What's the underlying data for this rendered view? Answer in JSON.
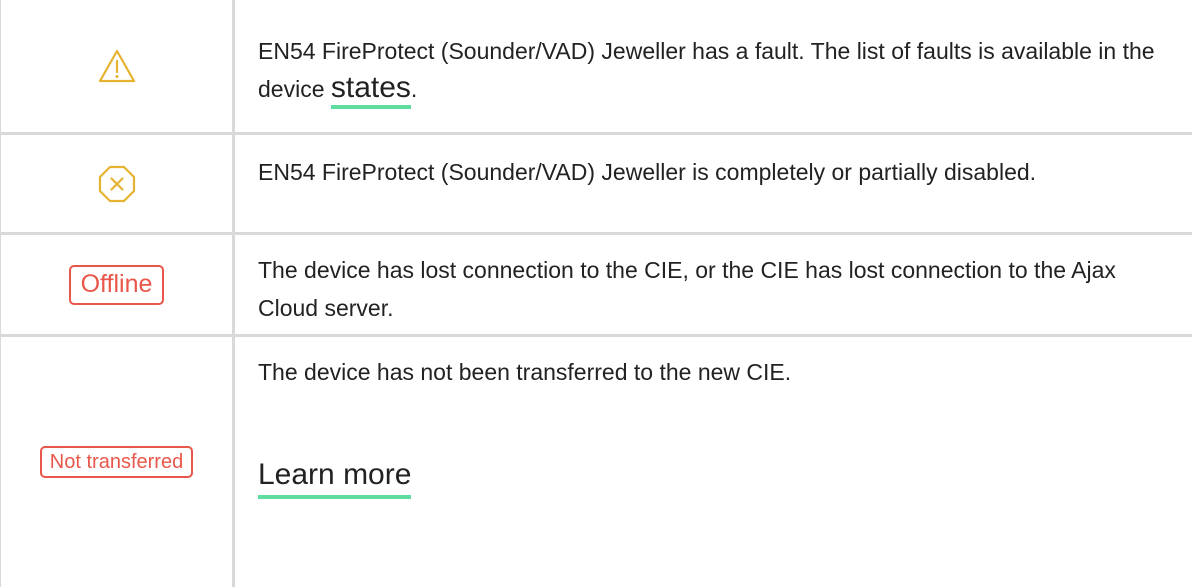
{
  "colors": {
    "warning": "#e5b330",
    "error": "#e9574a",
    "link_underline": "#5fdca0",
    "border": "#d9d9d9"
  },
  "rows": [
    {
      "icon": "warning-triangle-icon",
      "text": "EN54 FireProtect (Sounder/VAD) Jeweller has a fault. The list of faults is available in the device ",
      "link": "states",
      "suffix": "."
    },
    {
      "icon": "disabled-octagon-x-icon",
      "text": "EN54 FireProtect (Sounder/VAD) Jeweller is completely or partially disabled."
    },
    {
      "badge": "Offline",
      "text": "The device has lost connection to the CIE, or the CIE has lost connection to the Ajax Cloud server."
    },
    {
      "badge": "Not transferred",
      "text": "The device has not been transferred to the new CIE.",
      "link": "Learn more"
    }
  ]
}
